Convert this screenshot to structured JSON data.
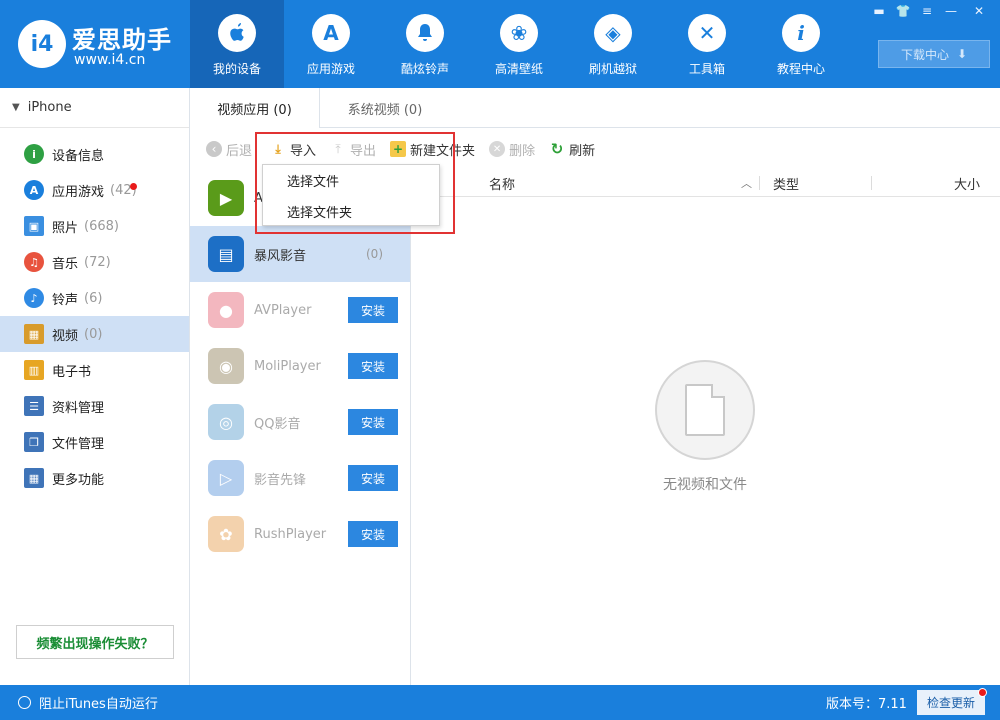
{
  "app": {
    "title": "爱思助手",
    "url": "www.i4.cn",
    "logo_mark": "i4"
  },
  "nav": [
    {
      "label": "我的设备",
      "icon": "apple-icon",
      "glyph": "",
      "active": true
    },
    {
      "label": "应用游戏",
      "icon": "app-store-icon",
      "glyph": "A"
    },
    {
      "label": "酷炫铃声",
      "icon": "bell-icon",
      "glyph": "♪"
    },
    {
      "label": "高清壁纸",
      "icon": "flower-icon",
      "glyph": "❀"
    },
    {
      "label": "刷机越狱",
      "icon": "dropbox-icon",
      "glyph": "◈"
    },
    {
      "label": "工具箱",
      "icon": "tools-icon",
      "glyph": "✕"
    },
    {
      "label": "教程中心",
      "icon": "info-icon",
      "glyph": "i"
    }
  ],
  "window_controls": [
    "▬",
    "👕",
    "≡",
    "—",
    "✕"
  ],
  "download": {
    "label": "下载中心",
    "icon": "download-arrow-icon",
    "glyph": "⬇"
  },
  "sidebar": {
    "device": "iPhone",
    "items": [
      {
        "label": "设备信息",
        "count": "",
        "icon": "info-icon",
        "color": "#2ea043",
        "glyph": "i"
      },
      {
        "label": "应用游戏",
        "count": "(42)",
        "icon": "app-store-icon",
        "color": "#1a7fdc",
        "glyph": "A",
        "dot": true
      },
      {
        "label": "照片",
        "count": "(668)",
        "icon": "photo-icon",
        "color": "#3a8fe0",
        "glyph": "▣"
      },
      {
        "label": "音乐",
        "count": "(72)",
        "icon": "music-icon",
        "color": "#e8533e",
        "glyph": "♫"
      },
      {
        "label": "铃声",
        "count": "(6)",
        "icon": "bell-icon",
        "color": "#2f8ae4",
        "glyph": "♪"
      },
      {
        "label": "视频",
        "count": "(0)",
        "icon": "video-icon",
        "color": "#d89b2b",
        "glyph": "▦",
        "active": true
      },
      {
        "label": "电子书",
        "count": "",
        "icon": "book-icon",
        "color": "#e7a623",
        "glyph": "▥"
      },
      {
        "label": "资料管理",
        "count": "",
        "icon": "contacts-icon",
        "color": "#3f74b8",
        "glyph": "☰"
      },
      {
        "label": "文件管理",
        "count": "",
        "icon": "files-icon",
        "color": "#3f74b8",
        "glyph": "❐"
      },
      {
        "label": "更多功能",
        "count": "",
        "icon": "grid-icon",
        "color": "#3f74b8",
        "glyph": "▦"
      }
    ],
    "help": "频繁出现操作失败？"
  },
  "tabs": [
    {
      "label": "视频应用 (0)",
      "active": true
    },
    {
      "label": "系统视频 (0)",
      "active": false
    }
  ],
  "toolbar": {
    "back": "后退",
    "import": "导入",
    "export": "导出",
    "new_folder": "新建文件夹",
    "delete": "删除",
    "refresh": "刷新"
  },
  "dropdown": {
    "items": [
      "选择文件",
      "选择文件夹"
    ]
  },
  "apps": [
    {
      "name": "A",
      "count": "",
      "color": "#5a9b1a",
      "glyph": "▶",
      "faded": false,
      "install": ""
    },
    {
      "name": "暴风影音",
      "count": "(0)",
      "color": "#1d6fc6",
      "glyph": "▤",
      "faded": false,
      "selected": true,
      "install": ""
    },
    {
      "name": "AVPlayer",
      "count": "",
      "color": "#e2455a",
      "glyph": "●",
      "faded": true,
      "install": "安装"
    },
    {
      "name": "MoliPlayer",
      "count": "",
      "color": "#7a6a3a",
      "glyph": "◉",
      "faded": true,
      "install": "安装"
    },
    {
      "name": "QQ影音",
      "count": "",
      "color": "#3a8cc4",
      "glyph": "◎",
      "faded": true,
      "install": "安装"
    },
    {
      "name": "影音先锋",
      "count": "",
      "color": "#3a7fd4",
      "glyph": "▷",
      "faded": true,
      "install": "安装"
    },
    {
      "name": "RushPlayer",
      "count": "",
      "color": "#e28a2a",
      "glyph": "✿",
      "faded": true,
      "install": "安装"
    }
  ],
  "table": {
    "col_name": "名称",
    "col_type": "类型",
    "col_size": "大小",
    "empty": "无视频和文件"
  },
  "status": {
    "itunes": "阻止iTunes自动运行",
    "version": "版本号：7.11",
    "update": "检查更新"
  },
  "colors": {
    "brand": "#1a7fdc",
    "selection": "#cfe0f5",
    "install": "#2c87e0",
    "highlight": "#e13333"
  }
}
